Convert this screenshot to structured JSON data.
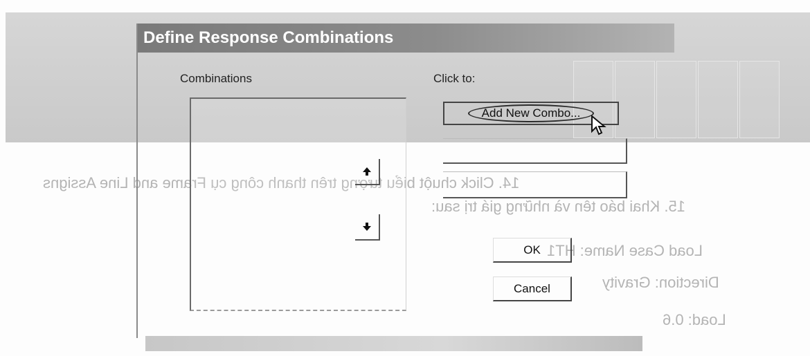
{
  "dialog": {
    "title": "Define Response Combinations",
    "combinations_label": "Combinations",
    "click_to_label": "Click to:",
    "add_new_combo_label": "Add New Combo...",
    "ok_label": "OK",
    "cancel_label": "Cancel",
    "move_up_icon": "up-arrow-icon",
    "move_down_icon": "down-arrow-icon"
  },
  "background_text": {
    "line1": "14. Click chuột biểu tượng       trên thanh công cụ Frame and Line Assigns",
    "line2": "15. Khai báo tên và những giá trị sau:",
    "line3": "Load Case Name: HT1",
    "line4": "Direction: Gravity",
    "line5": "Load: 0.6"
  },
  "colors": {
    "titlebar": "#7a7a7a",
    "background_strip": "#cfcfcf"
  }
}
